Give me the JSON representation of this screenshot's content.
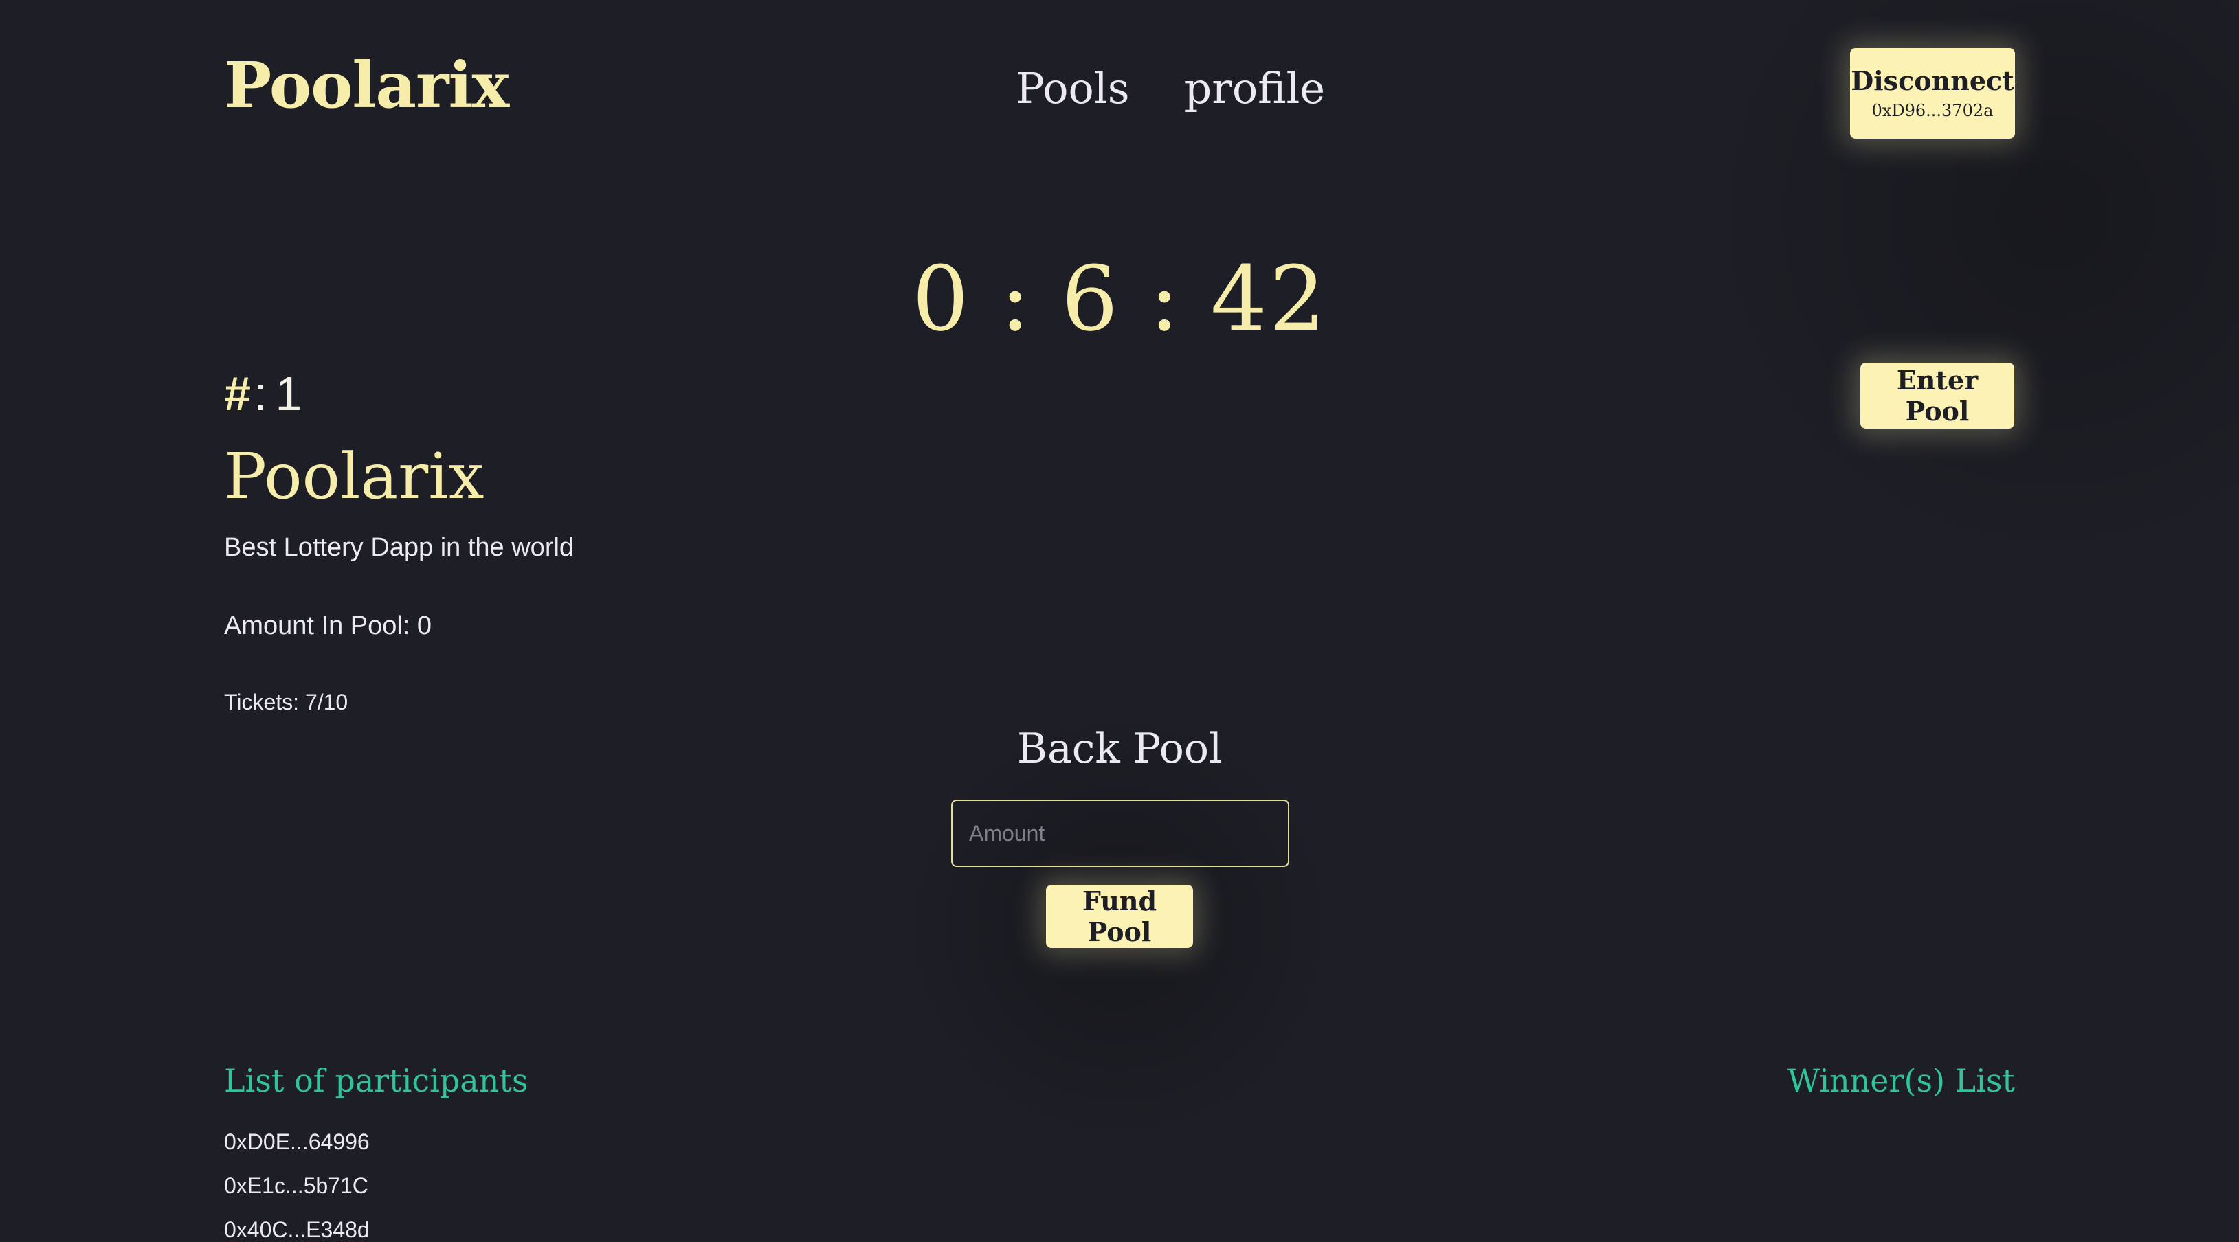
{
  "header": {
    "logo": "Poolarix",
    "nav": [
      "Pools",
      "profile"
    ],
    "disconnect_label": "Disconnect",
    "wallet_address": "0xD96...3702a"
  },
  "timer": "0 : 6 : 42",
  "pool": {
    "id_symbol": "#",
    "id_separator": ":",
    "id": "1",
    "name": "Poolarix",
    "description": "Best Lottery Dapp in the world",
    "amount_text": "Amount In Pool: 0",
    "tickets_text": "Tickets: 7/10",
    "enter_label": "Enter Pool"
  },
  "back_pool": {
    "title": "Back Pool",
    "amount_placeholder": "Amount",
    "fund_label": "Fund Pool"
  },
  "participants": {
    "title": "List of participants",
    "items": [
      "0xD0E...64996",
      "0xE1c...5b71C",
      "0x40C...E348d"
    ]
  },
  "winners": {
    "title": "Winner(s) List"
  },
  "colors": {
    "background": "#1e1f26",
    "accent": "#f7edaa",
    "button": "#fbf2b4",
    "list_title": "#2fc49a"
  }
}
